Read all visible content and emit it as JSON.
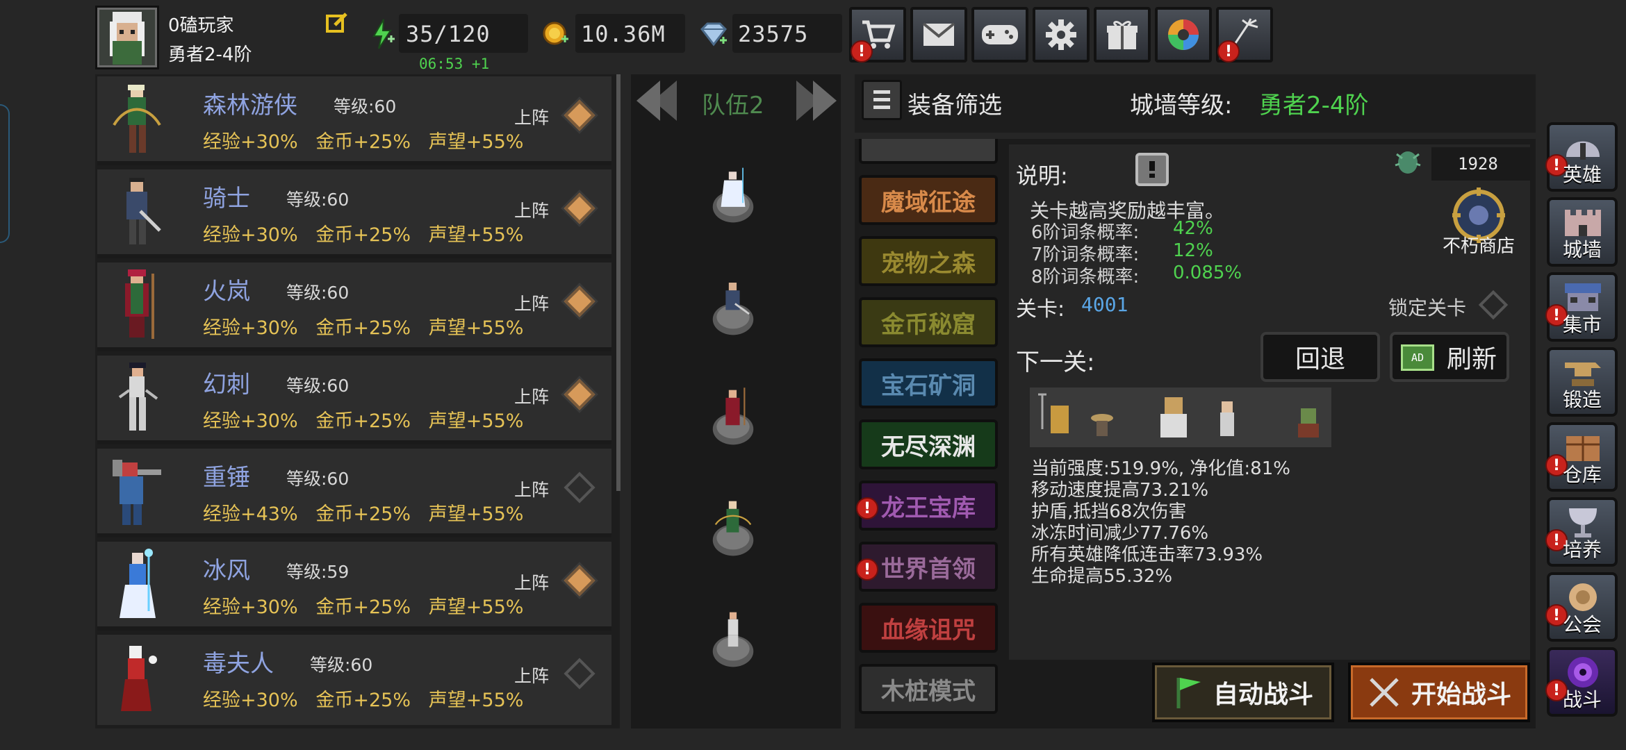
{
  "player": {
    "name": "0磕玩家",
    "rank": "勇者2-4阶"
  },
  "resources": {
    "energy": "35/120",
    "energy_timer": "06:53 +1",
    "gold": "10.36M",
    "gems": "23575"
  },
  "top_buttons": [
    {
      "icon": "cart-icon",
      "alert": true
    },
    {
      "icon": "mail-icon",
      "alert": false
    },
    {
      "icon": "gamepad-icon",
      "alert": false
    },
    {
      "icon": "gear-icon",
      "alert": false
    },
    {
      "icon": "gift-icon",
      "alert": false
    },
    {
      "icon": "aperture-icon",
      "alert": false
    },
    {
      "icon": "sparkle-icon",
      "alert": true
    }
  ],
  "alert_mark": "!",
  "heroes": [
    {
      "name": "森林游侠",
      "level": "等级:60",
      "stats": "经验+30%   金币+25%   声望+55%",
      "deploy": "上阵",
      "active": true
    },
    {
      "name": "骑士",
      "level": "等级:60",
      "stats": "经验+30%   金币+25%   声望+55%",
      "deploy": "上阵",
      "active": true
    },
    {
      "name": "火岚",
      "level": "等级:60",
      "stats": "经验+30%   金币+25%   声望+55%",
      "deploy": "上阵",
      "active": true
    },
    {
      "name": "幻刺",
      "level": "等级:60",
      "stats": "经验+30%   金币+25%   声望+55%",
      "deploy": "上阵",
      "active": true
    },
    {
      "name": "重锤",
      "level": "等级:60",
      "stats": "经验+43%   金币+25%   声望+55%",
      "deploy": "上阵",
      "active": false
    },
    {
      "name": "冰风",
      "level": "等级:59",
      "stats": "经验+30%   金币+25%   声望+55%",
      "deploy": "上阵",
      "active": true
    },
    {
      "name": "毒夫人",
      "level": "等级:60",
      "stats": "经验+30%   金币+25%   声望+55%",
      "deploy": "上阵",
      "active": false
    }
  ],
  "team": {
    "label": "队伍2"
  },
  "filter": {
    "label": "装备筛选",
    "wall_label": "城墙等级:",
    "wall_value": "勇者2-4阶"
  },
  "stages": [
    {
      "label": "魔域征途",
      "alert": false
    },
    {
      "label": "宠物之森",
      "alert": false
    },
    {
      "label": "金币秘窟",
      "alert": false
    },
    {
      "label": "宝石矿洞",
      "alert": false
    },
    {
      "label": "无尽深渊",
      "alert": false
    },
    {
      "label": "龙王宝库",
      "alert": true
    },
    {
      "label": "世界首领",
      "alert": true
    },
    {
      "label": "血缘诅咒",
      "alert": false
    },
    {
      "label": "木桩模式",
      "alert": false
    }
  ],
  "info": {
    "description_label": "说明:",
    "desc_line": "关卡越高奖励越丰富。",
    "prob_6_label": "6阶词条概率:",
    "prob_6_value": "42%",
    "prob_7_label": "7阶词条概率:",
    "prob_7_value": "12%",
    "prob_8_label": "8阶词条概率:",
    "prob_8_value": "0.085%",
    "currency_value": "1928",
    "shop_label": "不朽商店",
    "stage_label": "关卡:",
    "stage_value": "4001",
    "lock_label": "锁定关卡",
    "next_label": "下一关:",
    "back_button": "回退",
    "refresh_button": "刷新",
    "ad_badge": "AD",
    "effects": [
      "当前强度:519.9%, 净化值:81%",
      "移动速度提高73.21%",
      "护盾,抵挡68次伤害",
      "冰冻时间减少77.76%",
      "所有英雄降低连击率73.93%",
      "生命提高55.32%"
    ]
  },
  "battle": {
    "auto_label": "自动战斗",
    "start_label": "开始战斗"
  },
  "side_nav": [
    {
      "label": "英雄",
      "icon": "helmet-icon",
      "alert": true
    },
    {
      "label": "城墙",
      "icon": "castle-icon",
      "alert": false
    },
    {
      "label": "集市",
      "icon": "market-icon",
      "alert": true
    },
    {
      "label": "锻造",
      "icon": "anvil-icon",
      "alert": false
    },
    {
      "label": "仓库",
      "icon": "warehouse-icon",
      "alert": true
    },
    {
      "label": "培养",
      "icon": "chalice-icon",
      "alert": true
    },
    {
      "label": "公会",
      "icon": "guild-icon",
      "alert": true
    },
    {
      "label": "战斗",
      "icon": "portal-icon",
      "alert": true
    }
  ],
  "colors": {
    "accent_green": "#4fd34f",
    "hero_name": "#8fa3e0",
    "stat_gold": "#e6c356",
    "alert_red": "#c8221c"
  }
}
